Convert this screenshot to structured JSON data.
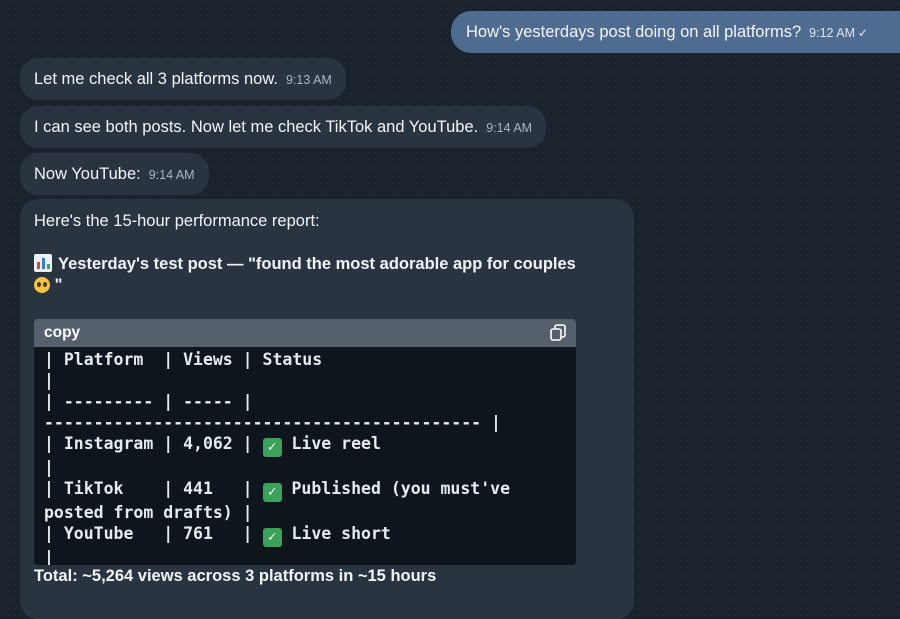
{
  "outgoing": {
    "text": "How's yesterdays post doing on all platforms?",
    "time": "9:12 AM",
    "status_tick": "✓"
  },
  "incoming": [
    {
      "text": "Let me check all 3 platforms now.",
      "time": "9:13 AM"
    },
    {
      "text": "I can see both posts. Now let me check TikTok and YouTube.",
      "time": "9:14 AM"
    },
    {
      "text": "Now YouTube:",
      "time": "9:14 AM"
    }
  ],
  "report": {
    "intro": "Here's the 15-hour performance report:",
    "title_line1": "Yesterday's test post — \"found the most adorable app for couples",
    "title_line2_suffix": " \"",
    "chart_emoji": "bar-chart-icon",
    "face_emoji": "pleading-face-icon",
    "code": {
      "header": "copy",
      "copy_icon": "copy-icon",
      "line_header": "| Platform  | Views | Status",
      "line_pipe1": "|",
      "line_sep": "| --------- | ----- |",
      "line_rule": "-------------------------------------------- |",
      "row1_pre": "| Instagram | 4,062 | ",
      "row1_status": "Live reel",
      "line_pipe2": "|",
      "row2_pre": "| TikTok    | 441   | ",
      "row2_status": "Published (you must've",
      "row2_cont": "posted from drafts) |",
      "row3_pre": "| YouTube   | 761   | ",
      "row3_status": "Live short",
      "line_pipe3": "|",
      "check_glyph": "✓"
    },
    "total": "Total: ~5,264 views across 3 platforms in ~15 hours"
  }
}
